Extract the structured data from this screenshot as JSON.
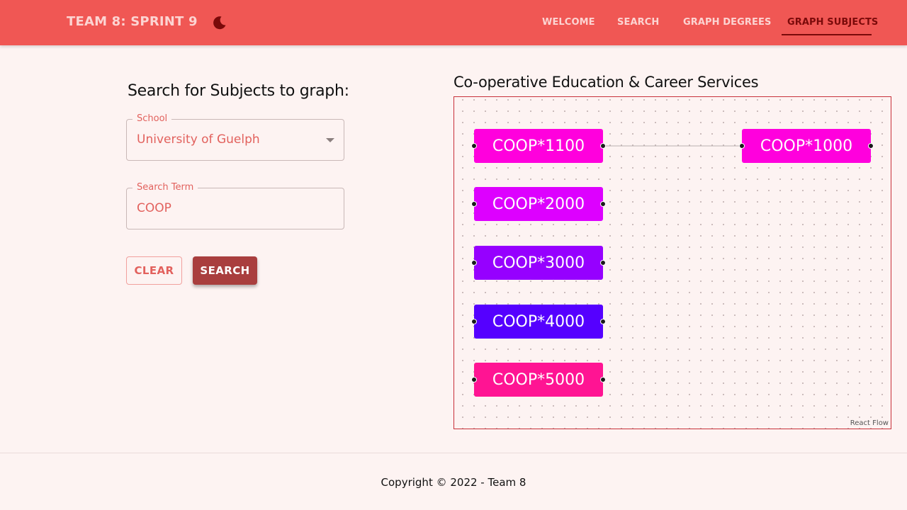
{
  "header": {
    "brand": "TEAM 8: SPRINT 9",
    "theme_icon": "moon-icon",
    "nav": [
      {
        "label": "WELCOME",
        "active": false
      },
      {
        "label": "SEARCH",
        "active": false
      },
      {
        "label": "GRAPH DEGREES",
        "active": false
      },
      {
        "label": "GRAPH SUBJECTS",
        "active": true
      }
    ],
    "colors": {
      "bar": "#f05754",
      "text": "#fcd4d2",
      "active": "#7a0a0a"
    }
  },
  "form": {
    "title": "Search for Subjects to graph:",
    "school": {
      "label": "School",
      "value": "University of Guelph"
    },
    "search_term": {
      "label": "Search Term",
      "value": "COOP"
    },
    "clear_label": "CLEAR",
    "search_label": "SEARCH"
  },
  "graph": {
    "title": "Co-operative Education & Career Services",
    "attribution": "React Flow",
    "nodes": [
      {
        "label": "COOP*1100",
        "color": "#ff00dd"
      },
      {
        "label": "COOP*1000",
        "color": "#ff00dd"
      },
      {
        "label": "COOP*2000",
        "color": "#dd00ff"
      },
      {
        "label": "COOP*3000",
        "color": "#9600ff"
      },
      {
        "label": "COOP*4000",
        "color": "#5500ff"
      },
      {
        "label": "COOP*5000",
        "color": "#ff1493"
      }
    ],
    "edges": [
      {
        "from": "COOP*1100",
        "to": "COOP*1000"
      }
    ]
  },
  "footer": {
    "copyright": "Copyright © 2022 - Team 8"
  }
}
